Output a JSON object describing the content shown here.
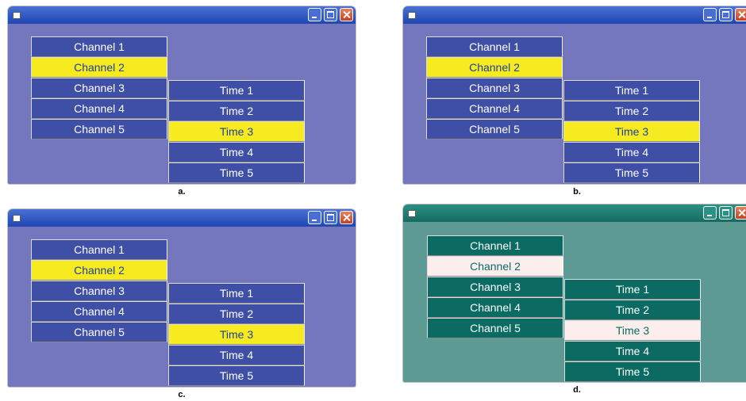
{
  "colors": {
    "blue_scheme": {
      "window_bg": "#7477bd",
      "titlebar_top": "#4a70d6",
      "titlebar_bottom": "#1f47b2",
      "button_bg": "#3f4fa6",
      "button_text": "#ffffff",
      "selected_bg": "#f6ea21",
      "selected_text": "#1f3f9e",
      "control_btn_bg": "#4a6ed8"
    },
    "teal_scheme": {
      "window_bg": "#5e9a94",
      "titlebar_top": "#2f8f84",
      "titlebar_bottom": "#156b61",
      "button_bg": "#0b6b62",
      "button_text": "#ffffff",
      "selected_bg": "#fdeeee",
      "selected_text": "#0b6b62",
      "control_btn_bg": "#2a9187"
    }
  },
  "panels": [
    {
      "caption": "a.",
      "scheme": "blue_scheme",
      "channels": [
        "Channel 1",
        "Channel 2",
        "Channel 3",
        "Channel 4",
        "Channel 5"
      ],
      "selected_channel": 1,
      "times": [
        "Time 1",
        "Time 2",
        "Time 3",
        "Time 4",
        "Time 5"
      ],
      "selected_time": 2
    },
    {
      "caption": "b.",
      "scheme": "blue_scheme",
      "channels": [
        "Channel 1",
        "Channel 2",
        "Channel 3",
        "Channel 4",
        "Channel 5"
      ],
      "selected_channel": 1,
      "times": [
        "Time 1",
        "Time 2",
        "Time 3",
        "Time 4",
        "Time 5"
      ],
      "selected_time": 2
    },
    {
      "caption": "c.",
      "scheme": "blue_scheme",
      "channels": [
        "Channel 1",
        "Channel 2",
        "Channel 3",
        "Channel 4",
        "Channel 5"
      ],
      "selected_channel": 1,
      "times": [
        "Time 1",
        "Time 2",
        "Time 3",
        "Time 4",
        "Time 5"
      ],
      "selected_time": 2
    },
    {
      "caption": "d.",
      "scheme": "teal_scheme",
      "channels": [
        "Channel 1",
        "Channel 2",
        "Channel 3",
        "Channel 4",
        "Channel 5"
      ],
      "selected_channel": 1,
      "times": [
        "Time 1",
        "Time 2",
        "Time 3",
        "Time 4",
        "Time 5"
      ],
      "selected_time": 2
    }
  ]
}
